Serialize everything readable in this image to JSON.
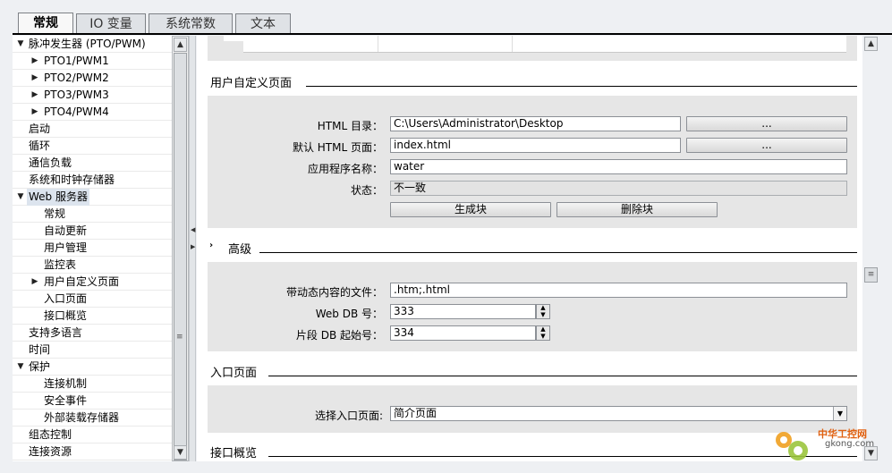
{
  "tabs": [
    {
      "label": "常规",
      "active": true
    },
    {
      "label": "IO 变量",
      "active": false
    },
    {
      "label": "系统常数",
      "active": false
    },
    {
      "label": "文本",
      "active": false
    }
  ],
  "tree": {
    "items": [
      {
        "label": "脉冲发生器 (PTO/PWM)",
        "level": 0,
        "arrow": "down",
        "selected": false
      },
      {
        "label": "PTO1/PWM1",
        "level": 1,
        "arrow": "right",
        "selected": false
      },
      {
        "label": "PTO2/PWM2",
        "level": 1,
        "arrow": "right",
        "selected": false
      },
      {
        "label": "PTO3/PWM3",
        "level": 1,
        "arrow": "right",
        "selected": false
      },
      {
        "label": "PTO4/PWM4",
        "level": 1,
        "arrow": "right",
        "selected": false
      },
      {
        "label": "启动",
        "level": 0,
        "arrow": "",
        "selected": false
      },
      {
        "label": "循环",
        "level": 0,
        "arrow": "",
        "selected": false
      },
      {
        "label": "通信负载",
        "level": 0,
        "arrow": "",
        "selected": false
      },
      {
        "label": "系统和时钟存储器",
        "level": 0,
        "arrow": "",
        "selected": false
      },
      {
        "label": "Web 服务器",
        "level": 0,
        "arrow": "down",
        "selected": true
      },
      {
        "label": "常规",
        "level": 1,
        "arrow": "",
        "selected": false
      },
      {
        "label": "自动更新",
        "level": 1,
        "arrow": "",
        "selected": false
      },
      {
        "label": "用户管理",
        "level": 1,
        "arrow": "",
        "selected": false
      },
      {
        "label": "监控表",
        "level": 1,
        "arrow": "",
        "selected": false
      },
      {
        "label": "用户自定义页面",
        "level": 1,
        "arrow": "right",
        "selected": false
      },
      {
        "label": "入口页面",
        "level": 1,
        "arrow": "",
        "selected": false
      },
      {
        "label": "接口概览",
        "level": 1,
        "arrow": "",
        "selected": false
      },
      {
        "label": "支持多语言",
        "level": 0,
        "arrow": "",
        "selected": false
      },
      {
        "label": "时间",
        "level": 0,
        "arrow": "",
        "selected": false
      },
      {
        "label": "保护",
        "level": 0,
        "arrow": "down",
        "selected": false
      },
      {
        "label": "连接机制",
        "level": 1,
        "arrow": "",
        "selected": false
      },
      {
        "label": "安全事件",
        "level": 1,
        "arrow": "",
        "selected": false
      },
      {
        "label": "外部装载存储器",
        "level": 1,
        "arrow": "",
        "selected": false
      },
      {
        "label": "组态控制",
        "level": 0,
        "arrow": "",
        "selected": false
      },
      {
        "label": "连接资源",
        "level": 0,
        "arrow": "",
        "selected": false
      }
    ]
  },
  "custom_pages": {
    "title": "用户自定义页面",
    "html_dir_label": "HTML 目录：",
    "html_dir_value": "C:\\Users\\Administrator\\Desktop",
    "browse_label": "...",
    "default_page_label": "默认 HTML 页面：",
    "default_page_value": "index.html",
    "browse2_label": "...",
    "app_name_label": "应用程序名称：",
    "app_name_value": "water",
    "status_label": "状态：",
    "status_value": "不一致",
    "generate_label": "生成块",
    "delete_label": "删除块"
  },
  "advanced": {
    "title": "高级",
    "dynamic_files_label": "带动态内容的文件：",
    "dynamic_files_value": ".htm;.html",
    "web_db_label": "Web DB 号：",
    "web_db_value": "333",
    "fragment_db_label": "片段 DB 起始号：",
    "fragment_db_value": "334"
  },
  "entry_page": {
    "title": "入口页面",
    "select_label": "选择入口页面:",
    "select_value": "简介页面"
  },
  "interface_overview": {
    "title": "接口概览"
  },
  "watermark": {
    "name": "中华工控网",
    "url": "gkong.com"
  },
  "colors": {
    "accent_orange": "#f0a020",
    "selection": "#dce4ee"
  }
}
